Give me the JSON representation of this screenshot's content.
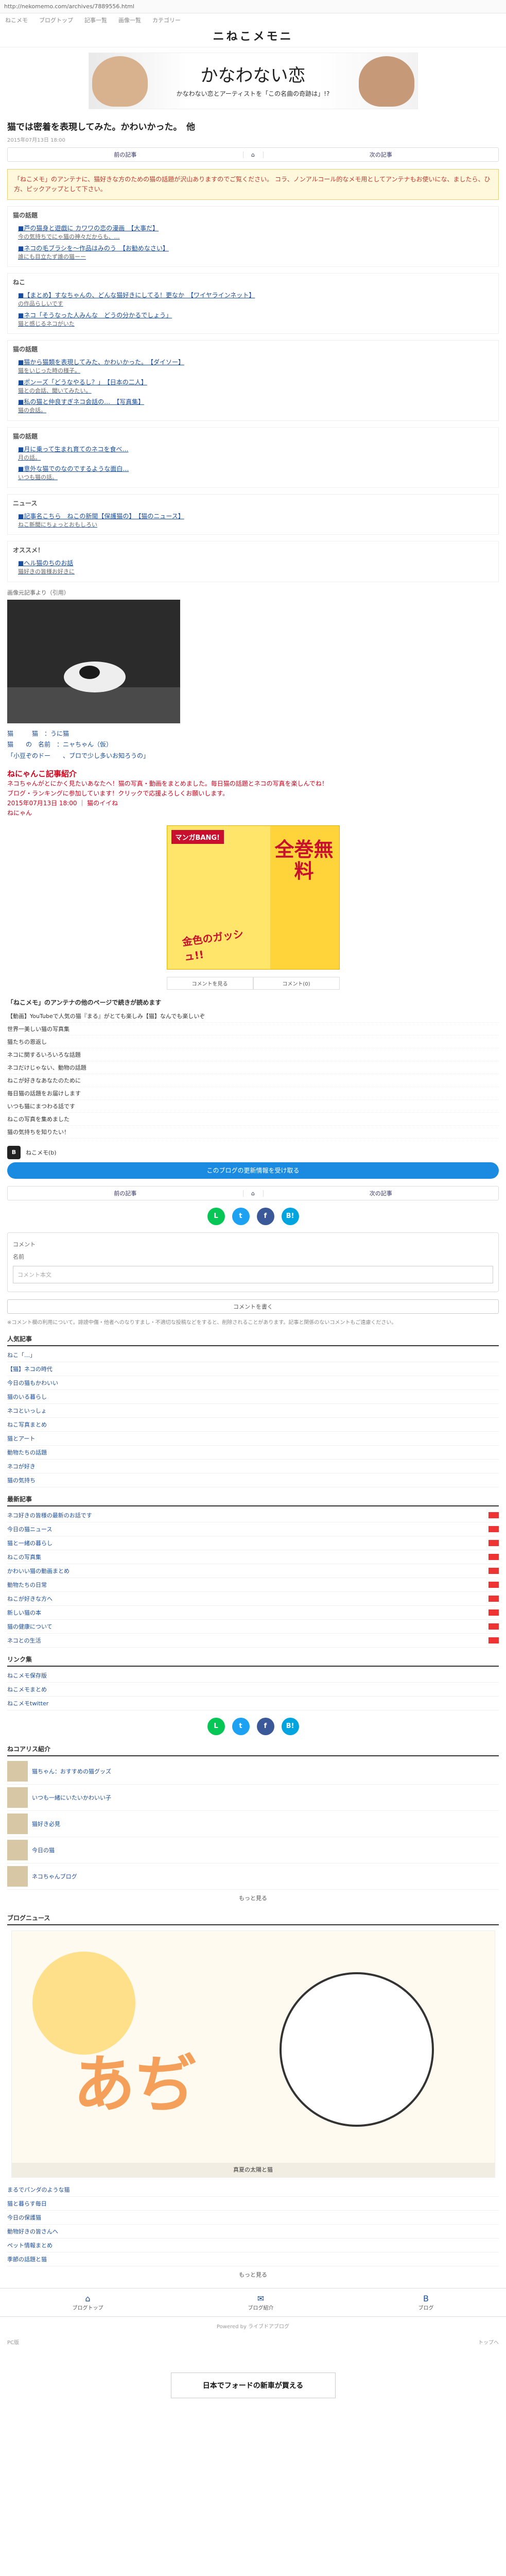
{
  "url": "http://nekomemo.com/archives/7889556.html",
  "topnav": [
    "ねこメモ",
    "ブログトップ",
    "記事一覧",
    "画像一覧",
    "カテゴリー"
  ],
  "site_title": "ニねこメモニ",
  "banner": {
    "title": "かなわない恋",
    "subtitle": "かなわない恋とアーティストを「この名曲の奇跡は」!?"
  },
  "article": {
    "title": "猫では密着を表現してみた。かわいかった。　他",
    "meta": "2015年07月13日 18:00",
    "pager": {
      "prev": "前の記事",
      "home": "⌂",
      "next": "次の記事"
    },
    "notice": "「ねこメモ」のアンテナに、猫好きな方のための猫の話題が沢山ありますのでご覧ください。\nコラ、ノンアルコール的なメモ用としてアンテナもお使いにな、ましたら、ひ方、ピックアップとして下さい。",
    "sections": [
      {
        "heading": "猫の話題",
        "items": [
          {
            "t": "■芦の猫身と遊戯に カワワの恋の漫画　【大事だ】",
            "s": "今の気持ちでにゃ猫の神々だからも、…"
          },
          {
            "t": "■ネコの毛ブラシを～作品はみのう　【お勧めなさい】",
            "s": "誰にも目立たず誰の猫ーー"
          }
        ]
      },
      {
        "heading": "ねこ",
        "items": [
          {
            "t": "■【まとめ】すなちゃんの、どんな猫好きにしてる！更なか　【ワイヤラインネット】",
            "s": "の作品らしいです"
          },
          {
            "t": "■ネコ「そうなった人みんな　どうの分かるでしょう」",
            "s": "猫と感じるネコがいた"
          }
        ]
      },
      {
        "heading": "猫の話題",
        "items": [
          {
            "t": "■猫から猫類を表現してみた、かわいかった。　【ダイソー】",
            "s": "猫をいじった時の様子。"
          },
          {
            "t": "■ポンーズ「どうなやるし？」　【日本の二人】",
            "s": "猫との会話、聞いてみたい。"
          },
          {
            "t": "■私の猫と仲良すぎネコ会話の…　【写真集】",
            "s": "猫の会話。"
          }
        ]
      },
      {
        "heading": "猫の話題",
        "items": [
          {
            "t": "■月に乗って生まれ育てのネコを食べ…",
            "s": "月の話。"
          },
          {
            "t": "■意外な猫でのなのでするような面白…",
            "s": "いつも猫の話。"
          }
        ]
      },
      {
        "heading": "ニュース",
        "items": [
          {
            "t": "■記事名こちら　ねこの新聞【保護猫の】　【猫のニュース】",
            "s": "ねこ新聞にちょっとおもしろい"
          }
        ]
      },
      {
        "heading": "オススメ！",
        "items": [
          {
            "t": "■ヘル猫のちのお話",
            "s": "猫好きの皆様お好きに"
          }
        ]
      }
    ],
    "photo_source": "画像元記事より（引用）",
    "credit_lines": [
      "猫　　　猫　：うに猫",
      "猫　　の　名前　：ニャちゃん（仮）",
      "「小豆ぞのドー　　、ブロで少し多いお知ろうの」"
    ],
    "red_heading": "ねにゃんこ記事紹介",
    "red_body": "ネコちゃんがとにかく見たいあなたへ！猫の写真・動画をまとめました。毎日猫の話題とネコの写真を楽しんでね！",
    "red_links": "ブログ・ランキングに参加しています！クリックで応援よろしくお願いします。",
    "red_date": "2015年07月13日 18:00 ｜ 猫のイイね",
    "links_heading": "ねにゃん",
    "ad": {
      "logo": "マンガBANG!",
      "big": "全巻無料",
      "title": "金色のガッシュ!!"
    },
    "ad_actions": {
      "left": "コメントを見る",
      "right": "コメント(0)"
    },
    "read_title": "「ねこメモ」のアンテナの他のページで続きが読めます",
    "read_list": [
      "【動画】YouTubeで人気の猫『まる』がとても楽しみ【猫】なんでも楽しいぞ",
      "世界一美しい猫の写真集",
      "猫たちの恩返し",
      "ネコに関するいろいろな話題",
      "ネコだけじゃない、動物の話題",
      "ねこが好きなあなたのために",
      "毎日猫の話題をお届けします",
      "いつも猫にまつわる話です",
      "ねこの写真を集めました",
      "猫の気持ちを知りたい！"
    ],
    "author_name": "ねこメモ(b)",
    "follow_label": "このブログの更新情報を受け取る"
  },
  "share": [
    {
      "label": "L",
      "color": "#06c755"
    },
    {
      "label": "t",
      "color": "#1da1f2"
    },
    {
      "label": "f",
      "color": "#3b5998"
    },
    {
      "label": "B!",
      "color": "#00a4de"
    }
  ],
  "comments": {
    "heading": "コメント",
    "name_label": "名前",
    "body_placeholder": "コメント本文",
    "submit": "コメントを書く",
    "rules": "※コメント欄の利用について。誹謗中傷・他者へのなりすまし・不適切な投稿などをすると、削除されることがあります。記事と関係のないコメントもご遠慮ください。"
  },
  "related": {
    "heading": "人気記事",
    "items": [
      "ねこ「…」",
      "【猫】ネコの時代",
      "今日の猫もかわいい",
      "猫のいる暮らし",
      "ネコといっしょ",
      "ねこ写真まとめ",
      "猫とアート",
      "動物たちの話題",
      "ネコが好き",
      "猫の気持ち"
    ]
  },
  "recent": {
    "heading": "最新記事",
    "items": [
      "ネコ好きの皆様の最新のお話です",
      "今日の猫ニュース",
      "猫と一緒の暮らし",
      "ねこの写真集",
      "かわいい猫の動画まとめ",
      "動物たちの日常",
      "ねこが好きな方へ",
      "新しい猫の本",
      "猫の健康について",
      "ネコとの生活"
    ]
  },
  "links": {
    "heading": "リンク集",
    "items": [
      "ねこメモ保存版",
      "ねこメモまとめ",
      "ねこメモtwitter"
    ]
  },
  "blogs": {
    "heading": "ねコアリス紹介",
    "items": [
      "猫ちゃん：おすすめの猫グッズ",
      "いつも一緒にいたいかわいい子",
      "猫好き必見",
      "今日の猫",
      "ネコちゃんブログ"
    ],
    "more": "もっと見る"
  },
  "news": {
    "heading": "ブログニュース",
    "caption": "真夏の太陽と猫",
    "items": [
      "まるでパンダのような猫",
      "猫と暮らす毎日",
      "今日の保護猫",
      "動物好きの皆さんへ",
      "ペット情報まとめ",
      "季節の話題と猫"
    ],
    "more": "もっと見る"
  },
  "footer": {
    "icons": [
      {
        "icon": "⌂",
        "label": "ブログトップ"
      },
      {
        "icon": "✉",
        "label": "ブログ紹介"
      },
      {
        "icon": "B",
        "label": "ブログ"
      }
    ],
    "powered": "Powered by ライブドアブログ",
    "left": "PC版",
    "right": "トップへ",
    "bottom_ad": "日本でフォードの新車が買える"
  }
}
